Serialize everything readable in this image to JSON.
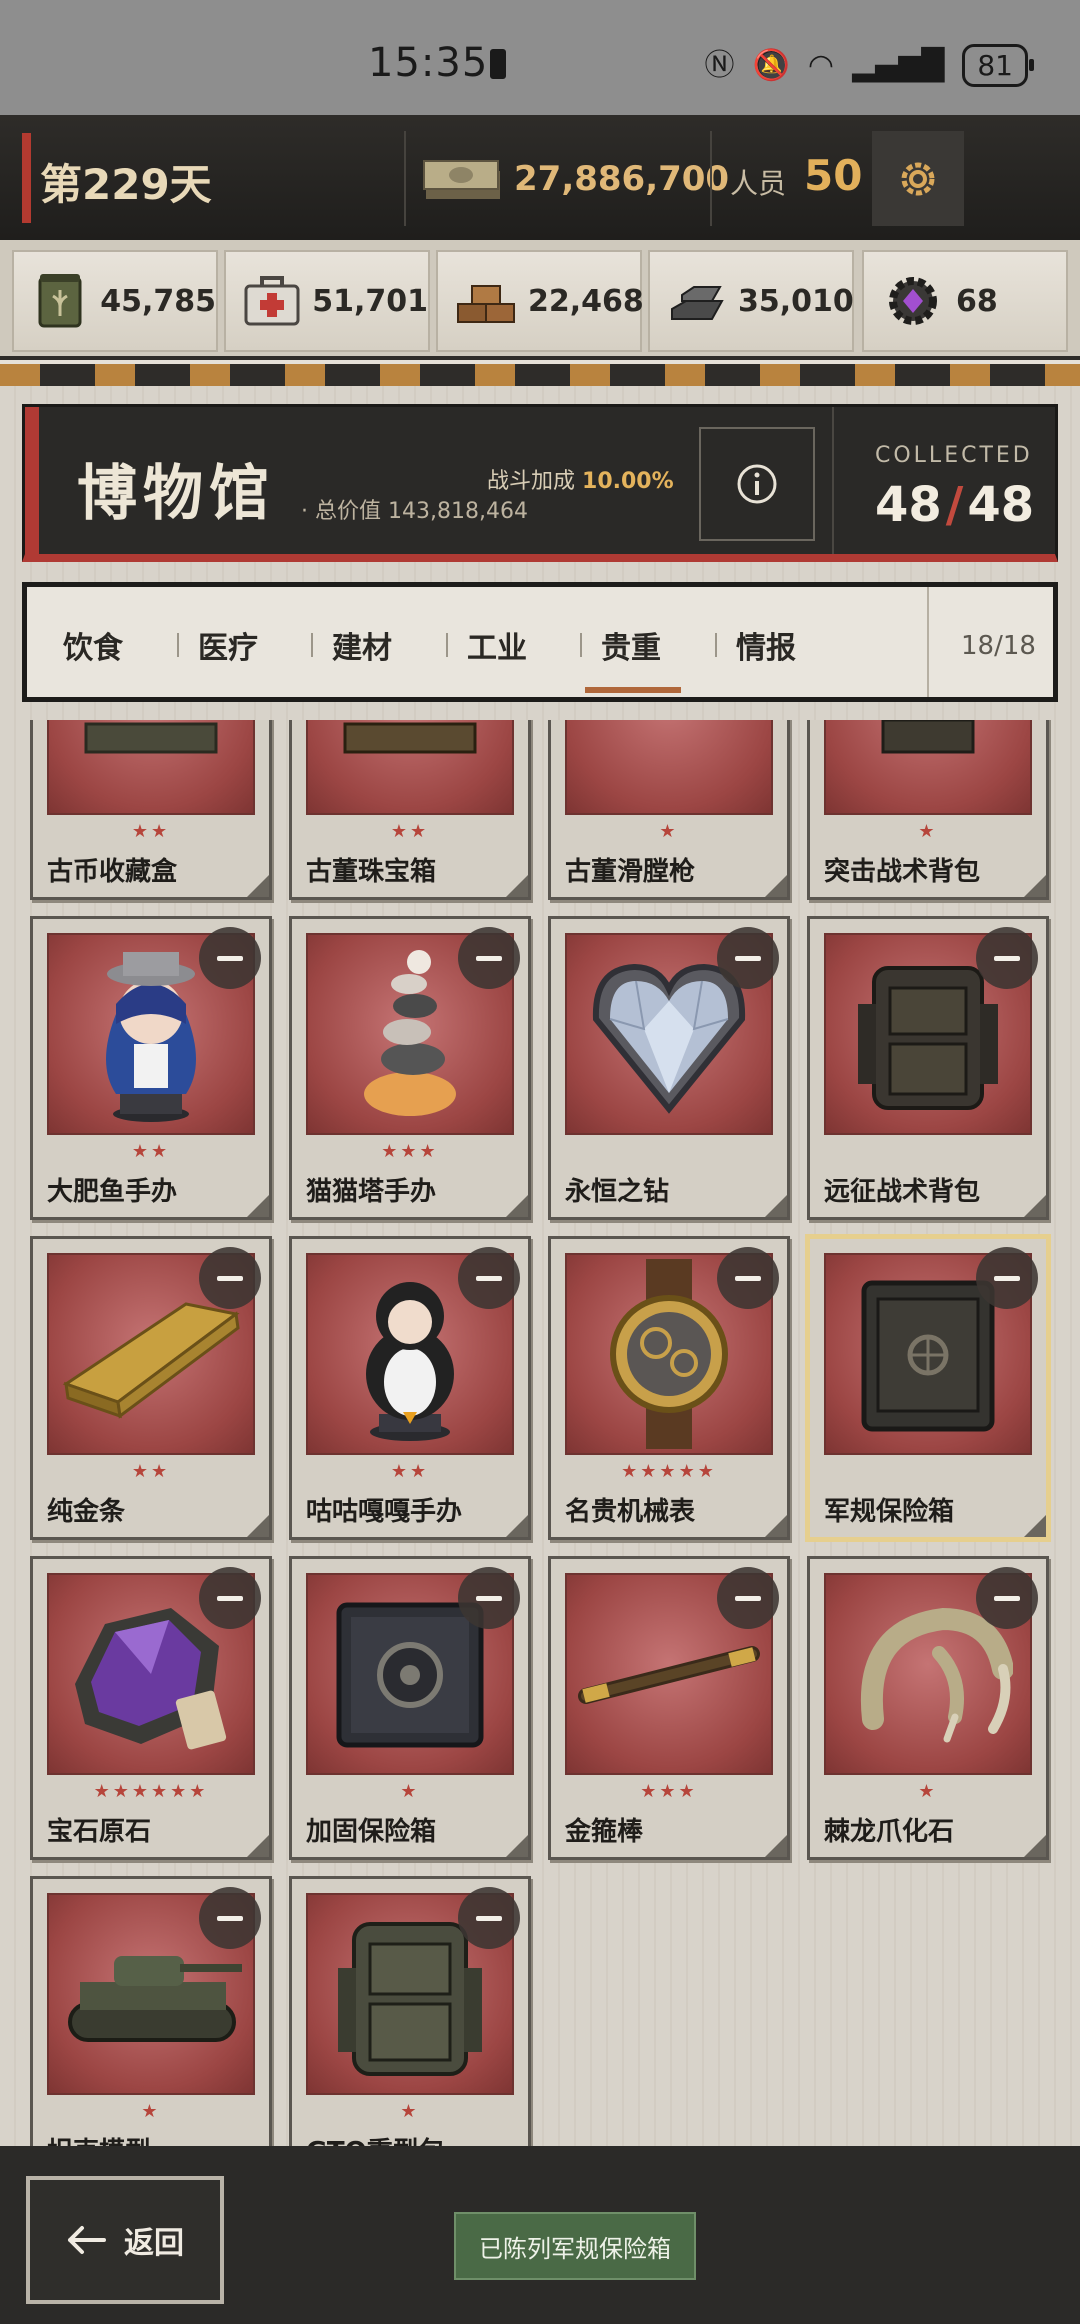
{
  "status_bar": {
    "time": "15:35",
    "battery": "81"
  },
  "topbar": {
    "day": "第229天",
    "money": "27,886,700",
    "staff_label": "人员",
    "staff_value": "50",
    "settings_icon": "gear-icon"
  },
  "resources": [
    {
      "icon": "food-can-icon",
      "value": "45,785"
    },
    {
      "icon": "medkit-icon",
      "value": "51,701"
    },
    {
      "icon": "bricks-icon",
      "value": "22,468"
    },
    {
      "icon": "iron-ingot-icon",
      "value": "35,010"
    },
    {
      "icon": "gear-crystal-icon",
      "value": "68"
    }
  ],
  "museum": {
    "title": "博物馆",
    "total_value": "· 总价值 143,818,464",
    "bonus_label": "战斗加成",
    "bonus_value": "10.00%",
    "collected_label": "COLLECTED",
    "collected": "48",
    "total": "48"
  },
  "tabs": {
    "items": [
      "饮食",
      "医疗",
      "建材",
      "工业",
      "贵重",
      "情报"
    ],
    "active": "贵重",
    "count": "18/18"
  },
  "items": [
    {
      "name": "古币收藏盒",
      "stars": "★★"
    },
    {
      "name": "古董珠宝箱",
      "stars": "★★"
    },
    {
      "name": "古董滑膛枪",
      "stars": "★"
    },
    {
      "name": "突击战术背包",
      "stars": "★"
    },
    {
      "name": "大肥鱼手办",
      "stars": "★★"
    },
    {
      "name": "猫猫塔手办",
      "stars": "★★★"
    },
    {
      "name": "永恒之钻",
      "stars": ""
    },
    {
      "name": "远征战术背包",
      "stars": ""
    },
    {
      "name": "纯金条",
      "stars": "★★"
    },
    {
      "name": "咕咕嘎嘎手办",
      "stars": "★★"
    },
    {
      "name": "名贵机械表",
      "stars": "★★★★★"
    },
    {
      "name": "军规保险箱",
      "stars": ""
    },
    {
      "name": "宝石原石",
      "stars": "★★★★★★"
    },
    {
      "name": "加固保险箱",
      "stars": "★"
    },
    {
      "name": "金箍棒",
      "stars": "★★★"
    },
    {
      "name": "棘龙爪化石",
      "stars": "★"
    },
    {
      "name": "坦克模型",
      "stars": "★"
    },
    {
      "name": "GTO重型包",
      "stars": "★"
    }
  ],
  "bottom": {
    "back_label": "返回",
    "toast": "已陈列军规保险箱"
  },
  "colors": {
    "accent_red": "#b03a34",
    "money_gold": "#e0b878",
    "tab_underline": "#b0673a",
    "toast_green": "#4a6a46"
  }
}
